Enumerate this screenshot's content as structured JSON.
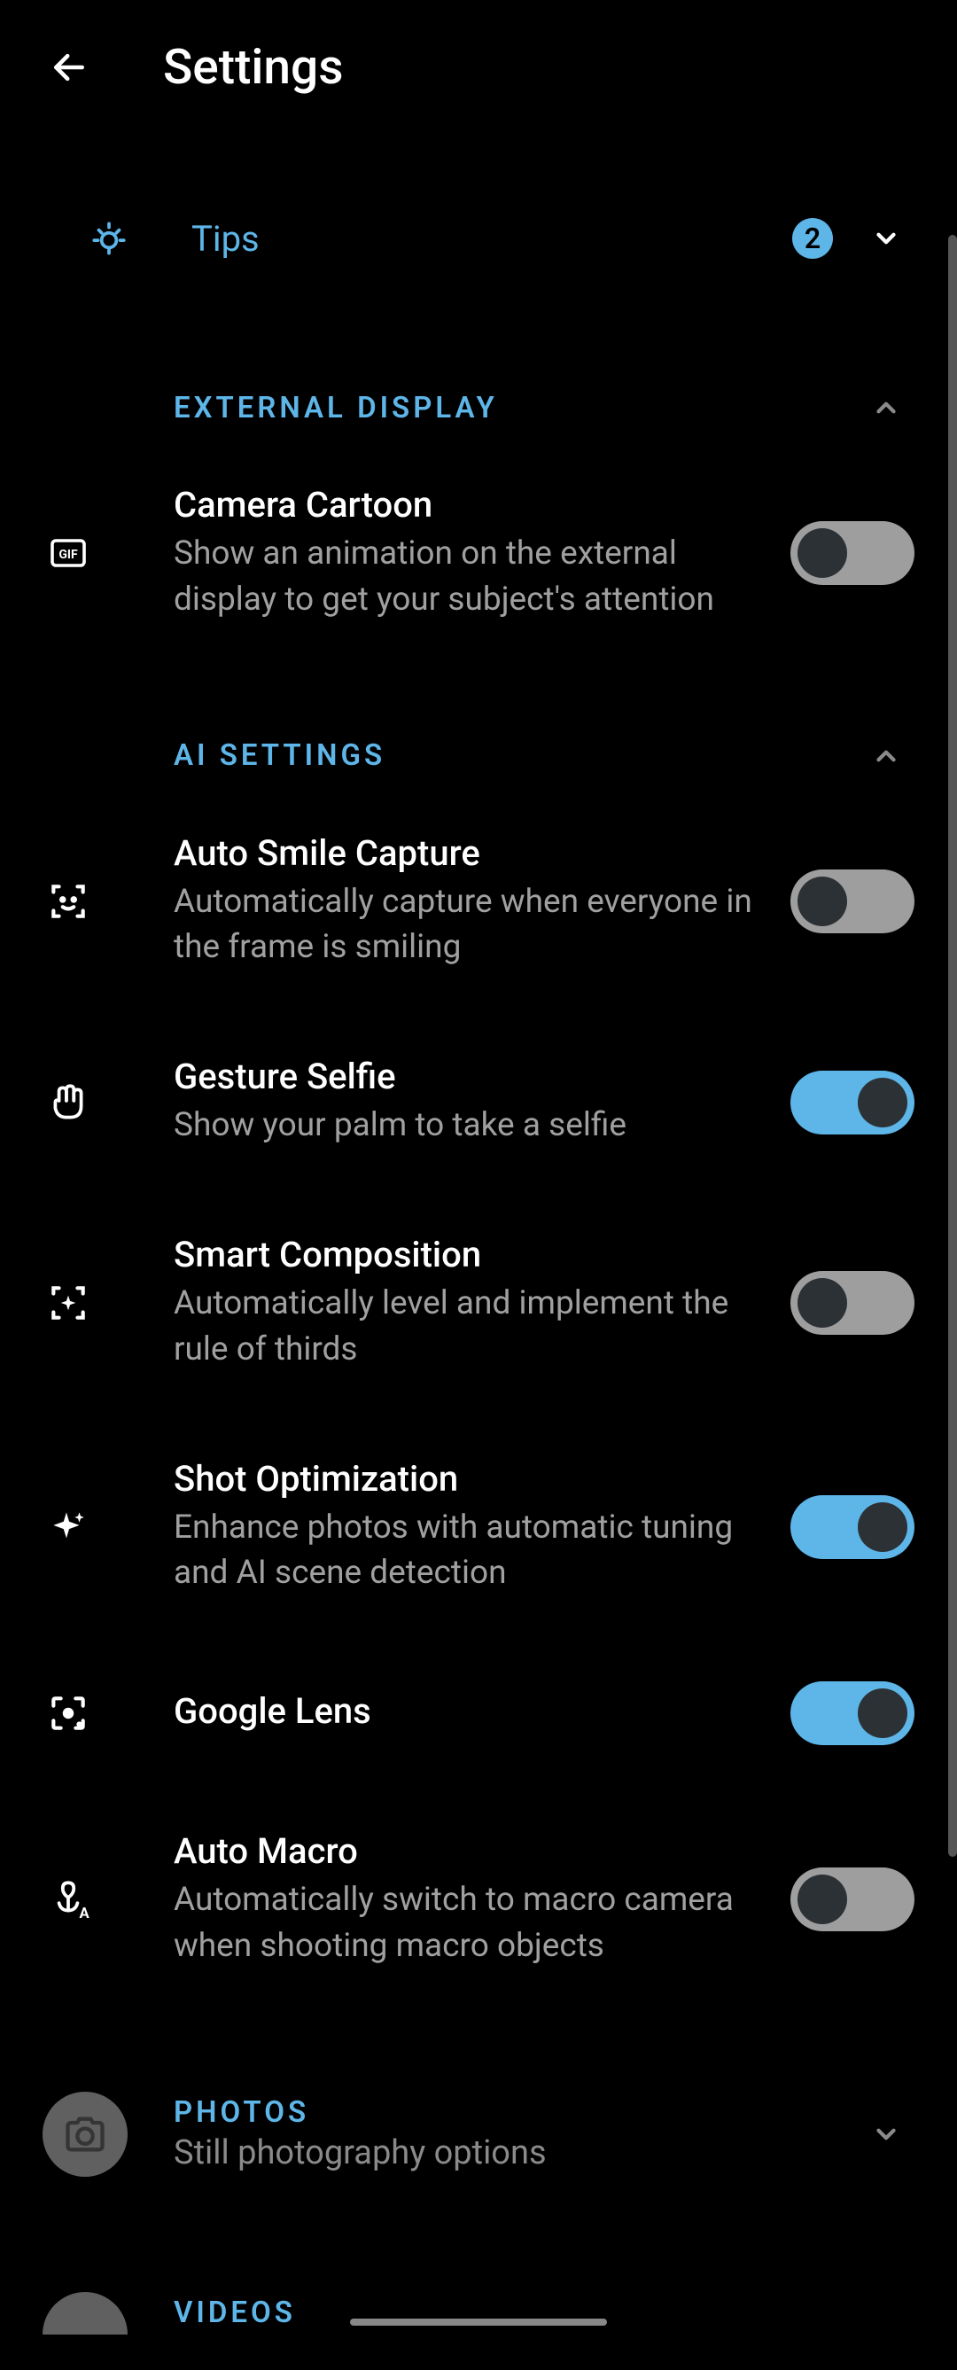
{
  "header": {
    "title": "Settings"
  },
  "tips": {
    "label": "Tips",
    "badge": "2"
  },
  "sections": {
    "external_display": {
      "title": "EXTERNAL DISPLAY"
    },
    "ai_settings": {
      "title": "AI SETTINGS"
    }
  },
  "settings": {
    "camera_cartoon": {
      "title": "Camera Cartoon",
      "desc": "Show an animation on the external display to get your subject's attention",
      "enabled": false
    },
    "auto_smile": {
      "title": "Auto Smile Capture",
      "desc": "Automatically capture when everyone in the frame is smiling",
      "enabled": false
    },
    "gesture_selfie": {
      "title": "Gesture Selfie",
      "desc": "Show your palm to take a selfie",
      "enabled": true
    },
    "smart_composition": {
      "title": "Smart Composition",
      "desc": "Automatically level and implement the rule of thirds",
      "enabled": false
    },
    "shot_optimization": {
      "title": "Shot Optimization",
      "desc": "Enhance photos with automatic tuning and AI scene detection",
      "enabled": true
    },
    "google_lens": {
      "title": "Google Lens",
      "enabled": true
    },
    "auto_macro": {
      "title": "Auto Macro",
      "desc": "Automatically switch to macro camera when shooting macro objects",
      "enabled": false
    }
  },
  "categories": {
    "photos": {
      "title": "PHOTOS",
      "desc": "Still photography options"
    },
    "videos": {
      "title": "VIDEOS"
    }
  }
}
